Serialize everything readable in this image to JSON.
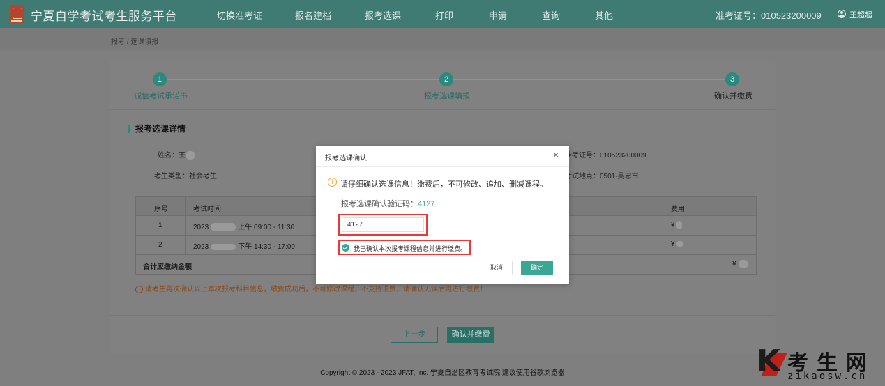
{
  "header": {
    "site_title": "宁夏自学考试考生服务平台",
    "nav": [
      "切换准考证",
      "报名建档",
      "报考选课",
      "打印",
      "申请",
      "查询",
      "其他"
    ],
    "ticket_label": "准考证号：010523200009",
    "user_name": "王超超"
  },
  "breadcrumb": "报考 / 选课填报",
  "steps": [
    {
      "num": "1",
      "label": "诚信考试承诺书"
    },
    {
      "num": "2",
      "label": "报考选课填报"
    },
    {
      "num": "3",
      "label": "确认并缴费"
    }
  ],
  "section_title": "报考选课详情",
  "info": {
    "name_label": "姓名：",
    "name_value": "王",
    "type_label": "考生类型：",
    "type_value": "社会考生",
    "ticket_label": "准考证号：",
    "ticket_value": "010523200009",
    "place_label": "考试地点：",
    "place_value": "0501-吴忠市"
  },
  "table": {
    "headers": {
      "no": "序号",
      "time": "考试时间",
      "fee": "费用"
    },
    "rows": [
      {
        "no": "1",
        "time_prefix": "2023",
        "time_suffix": "上午 09:00 - 11:30",
        "fee": "¥"
      },
      {
        "no": "2",
        "time_prefix": "2023",
        "time_suffix": "下午 14:30 - 17:00",
        "fee": "¥"
      }
    ],
    "total_label": "合计应缴纳金额",
    "total_value": "¥"
  },
  "warning": "请考生再次确认以上本次报考科目信息，缴费成功后，不可修改课程，不支持退费，请确认无误后再进行缴费！",
  "buttons": {
    "prev": "上一步",
    "next": "确认并缴费"
  },
  "footer": "Copyright © 2023 - 2023 JFAT, Inc. 宁夏自治区教育考试院 建议使用谷歌浏览器",
  "modal": {
    "title": "报考选课确认",
    "close": "×",
    "warning": "请仔细确认选课信息！缴费后，不可修改、追加、删减课程。",
    "code_label": "报考选课确认验证码：",
    "code": "4127",
    "input_value": "4127",
    "checkbox_label": "我已确认本次报考课程信息并进行缴费。",
    "cancel": "取消",
    "confirm": "确定"
  },
  "watermark": {
    "cn": "考生网",
    "en": "zikaosw.cn",
    "k": "K"
  },
  "colors": {
    "primary": "#3aa795",
    "nav_bg": "#3f7a73",
    "highlight": "#e53b3b",
    "warning": "#e6a23c"
  }
}
